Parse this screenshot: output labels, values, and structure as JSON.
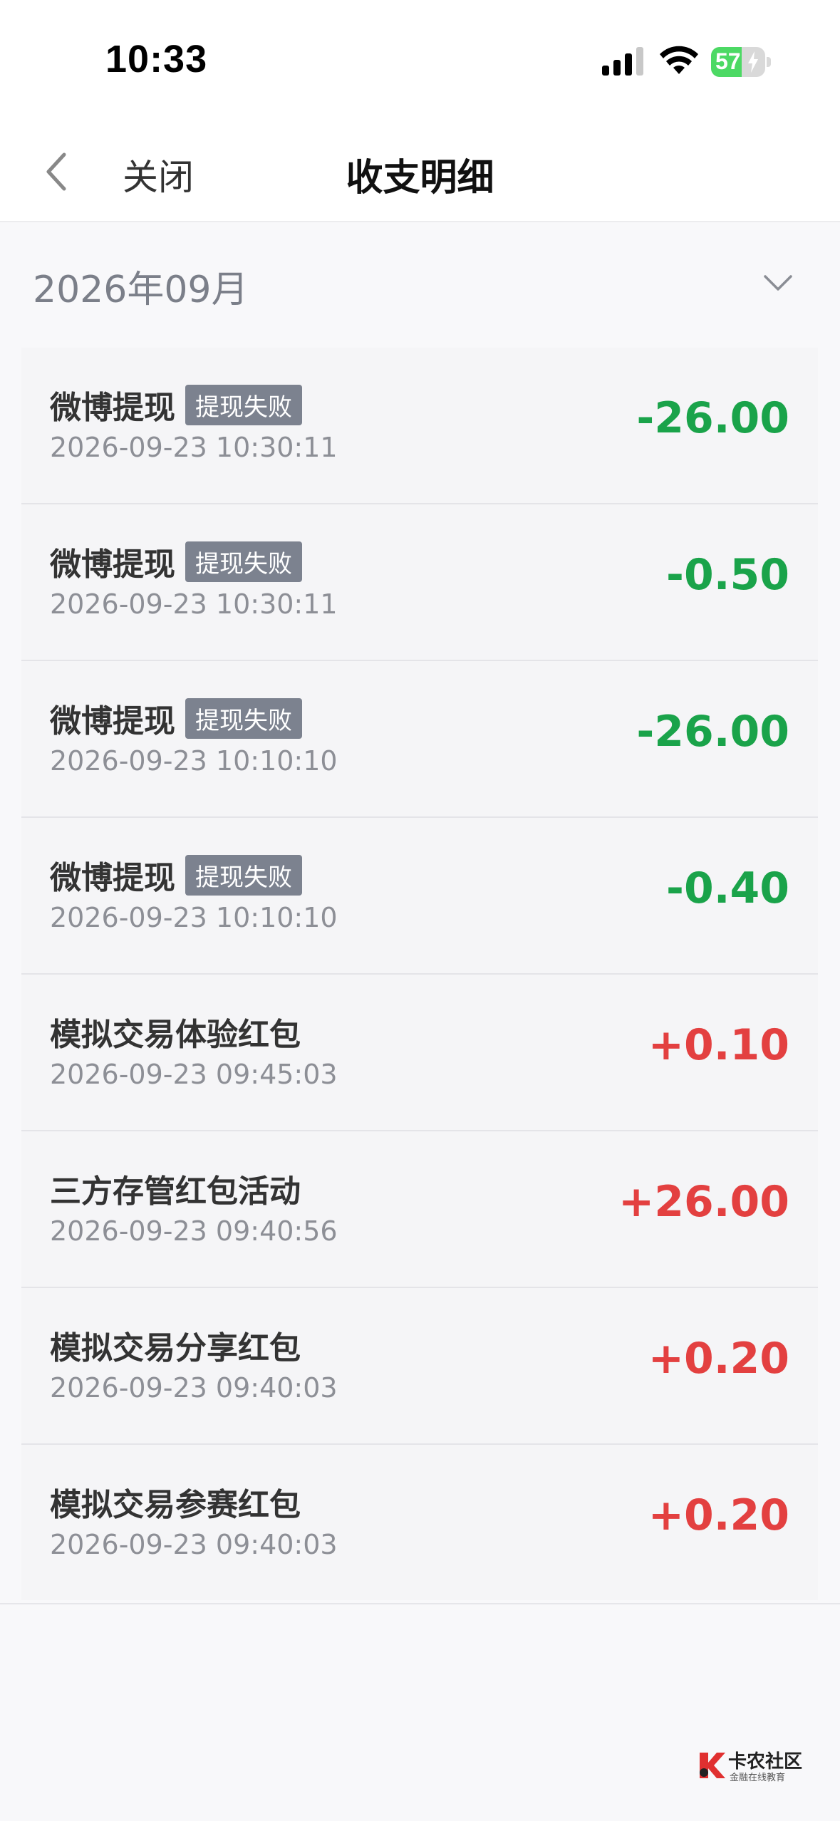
{
  "status_bar": {
    "time": "10:33",
    "battery_level": "57",
    "battery_percent": 57,
    "icons": [
      "signal-icon",
      "wifi-icon",
      "battery-icon"
    ]
  },
  "nav": {
    "close_label": "关闭",
    "title": "收支明细"
  },
  "month": {
    "label": "2026年09月"
  },
  "colors": {
    "expense": "#1aa34a",
    "income": "#e34040",
    "badge": "#7c828f"
  },
  "transactions": [
    {
      "title": "微博提现",
      "badge": "提现失败",
      "time": "2026-09-23 10:30:11",
      "amount": "-26.00",
      "type": "expense"
    },
    {
      "title": "微博提现",
      "badge": "提现失败",
      "time": "2026-09-23 10:30:11",
      "amount": "-0.50",
      "type": "expense"
    },
    {
      "title": "微博提现",
      "badge": "提现失败",
      "time": "2026-09-23 10:10:10",
      "amount": "-26.00",
      "type": "expense"
    },
    {
      "title": "微博提现",
      "badge": "提现失败",
      "time": "2026-09-23 10:10:10",
      "amount": "-0.40",
      "type": "expense"
    },
    {
      "title": "模拟交易体验红包",
      "badge": "",
      "time": "2026-09-23 09:45:03",
      "amount": "+0.10",
      "type": "income"
    },
    {
      "title": "三方存管红包活动",
      "badge": "",
      "time": "2026-09-23 09:40:56",
      "amount": "+26.00",
      "type": "income"
    },
    {
      "title": "模拟交易分享红包",
      "badge": "",
      "time": "2026-09-23 09:40:03",
      "amount": "+0.20",
      "type": "income"
    },
    {
      "title": "模拟交易参赛红包",
      "badge": "",
      "time": "2026-09-23 09:40:03",
      "amount": "+0.20",
      "type": "income"
    }
  ],
  "watermark": {
    "name": "卡农社区",
    "tagline": "金融在线教育"
  }
}
